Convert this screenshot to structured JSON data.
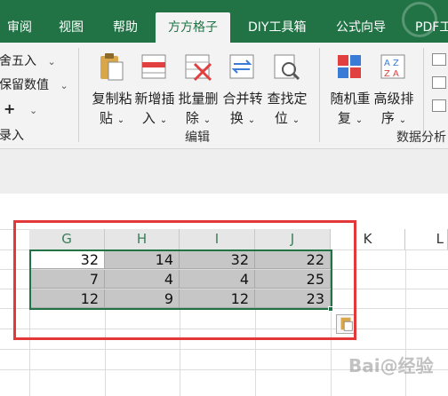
{
  "tabs": [
    "审阅",
    "视图",
    "帮助",
    "方方格子",
    "DIY工具箱",
    "公式向导",
    "PDF工"
  ],
  "left_items": {
    "round": "舍五入",
    "keep": "保留数值",
    "plus": "+",
    "input": "录入"
  },
  "buttons": [
    {
      "line1": "复制粘",
      "line2": "贴"
    },
    {
      "line1": "新增插",
      "line2": "入"
    },
    {
      "line1": "批量删",
      "line2": "除"
    },
    {
      "line1": "合并转",
      "line2": "换"
    },
    {
      "line1": "查找定",
      "line2": "位"
    },
    {
      "line1": "随机重",
      "line2": "复"
    },
    {
      "line1": "高级排",
      "line2": "序"
    }
  ],
  "groups": {
    "edit": "编辑",
    "analysis": "数据分析"
  },
  "columns": [
    "G",
    "H",
    "I",
    "J",
    "K",
    "L"
  ],
  "rows": [
    [
      32,
      14,
      32,
      22
    ],
    [
      7,
      4,
      4,
      25
    ],
    [
      12,
      9,
      12,
      23
    ]
  ],
  "watermark": "Bai@经验"
}
